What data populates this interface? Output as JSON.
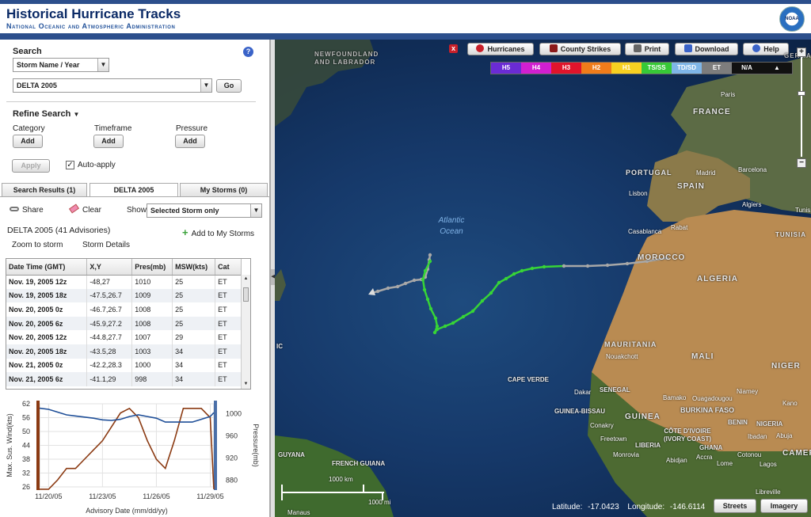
{
  "header": {
    "title": "Historical Hurricane Tracks",
    "subtitle": "National Oceanic and Atmospheric Administration",
    "logo_text": "NOAA"
  },
  "search": {
    "heading": "Search",
    "help": "?",
    "mode_select": "Storm Name / Year",
    "storm_value": "DELTA 2005",
    "go_label": "Go"
  },
  "refine": {
    "heading": "Refine Search",
    "category_label": "Category",
    "timeframe_label": "Timeframe",
    "pressure_label": "Pressure",
    "add_label": "Add",
    "apply_label": "Apply",
    "autoapply_label": "Auto-apply"
  },
  "tabs": [
    {
      "label": "Search Results (1)"
    },
    {
      "label": "DELTA 2005"
    },
    {
      "label": "My Storms (0)"
    }
  ],
  "toolbar": {
    "share_label": "Share",
    "clear_label": "Clear",
    "show_label": "Show",
    "show_value": "Selected Storm only"
  },
  "storm": {
    "title": "DELTA 2005 (41 Advisories)",
    "add_to_my_storms": "Add to My Storms",
    "zoom_label": "Zoom to storm",
    "details_label": "Storm Details"
  },
  "table": {
    "headers": [
      "Date Time (GMT)",
      "X,Y",
      "Pres(mb)",
      "MSW(kts)",
      "Cat"
    ],
    "rows": [
      [
        "Nov. 19, 2005 12z",
        "-48,27",
        "1010",
        "25",
        "ET"
      ],
      [
        "Nov. 19, 2005 18z",
        "-47.5,26.7",
        "1009",
        "25",
        "ET"
      ],
      [
        "Nov. 20, 2005 0z",
        "-46.7,26.7",
        "1008",
        "25",
        "ET"
      ],
      [
        "Nov. 20, 2005 6z",
        "-45.9,27.2",
        "1008",
        "25",
        "ET"
      ],
      [
        "Nov. 20, 2005 12z",
        "-44.8,27.7",
        "1007",
        "29",
        "ET"
      ],
      [
        "Nov. 20, 2005 18z",
        "-43.5,28",
        "1003",
        "34",
        "ET"
      ],
      [
        "Nov. 21, 2005 0z",
        "-42.2,28.3",
        "1000",
        "34",
        "ET"
      ],
      [
        "Nov. 21, 2005 6z",
        "-41.1,29",
        "998",
        "34",
        "ET"
      ]
    ]
  },
  "chart_data": {
    "type": "line",
    "xlabel": "Advisory Date (mm/dd/yy)",
    "ylabel": "Max. Sus. Wind(kts)",
    "y2label": "Pressure(mb)",
    "x_ticks": [
      "11/20/05",
      "11/23/05",
      "11/26/05",
      "11/29/05"
    ],
    "y_ticks": [
      26,
      32,
      38,
      44,
      50,
      56,
      62
    ],
    "y2_ticks": [
      880,
      920,
      960,
      1000
    ],
    "ylim": [
      26,
      62
    ],
    "y2lim": [
      868,
      1018
    ],
    "x": [
      19.5,
      20.0,
      20.5,
      21.0,
      21.5,
      22.0,
      22.5,
      23.0,
      23.5,
      24.0,
      24.5,
      25.0,
      25.5,
      26.0,
      26.5,
      27.0,
      27.5,
      28.0,
      28.5,
      29.0,
      29.2
    ],
    "series": [
      {
        "values": [
          25,
          25,
          29,
          34,
          34,
          38,
          42,
          46,
          52,
          58,
          60,
          56,
          46,
          38,
          34,
          46,
          60,
          60,
          60,
          56,
          25
        ],
        "color": "#8b3a12"
      },
      {
        "values": [
          1010,
          1008,
          1003,
          998,
          996,
          994,
          992,
          989,
          988,
          990,
          995,
          998,
          995,
          992,
          985,
          985,
          985,
          985,
          990,
          995,
          1002
        ],
        "color": "#1f4f98"
      }
    ]
  },
  "map": {
    "buttons": {
      "hurricanes": "Hurricanes",
      "county_strikes": "County Strikes",
      "print": "Print",
      "download": "Download",
      "help": "Help"
    },
    "close": "x",
    "legend": [
      {
        "label": "H5",
        "bg": "#6a2bd4",
        "fg": "#ffffff"
      },
      {
        "label": "H4",
        "bg": "#d11fd1",
        "fg": "#ffffff"
      },
      {
        "label": "H3",
        "bg": "#e0142b",
        "fg": "#ffffff"
      },
      {
        "label": "H2",
        "bg": "#f07c1a",
        "fg": "#ffffff"
      },
      {
        "label": "H1",
        "bg": "#f7d021",
        "fg": "#ffffff"
      },
      {
        "label": "TS/SS",
        "bg": "#37c937",
        "fg": "#ffffff"
      },
      {
        "label": "TD/SD",
        "bg": "#7fb6e8",
        "fg": "#ffffff"
      },
      {
        "label": "ET",
        "bg": "#7d7d7d",
        "fg": "#ffffff"
      },
      {
        "label": "N/A",
        "bg": "#111111",
        "fg": "#ffffff"
      },
      {
        "label": "▲",
        "bg": "#111111",
        "fg": "#ffffff"
      }
    ],
    "places": {
      "newfoundland": "NEWFOUNDLAND AND LABRADOR",
      "france": "FRANCE",
      "paris": "Paris",
      "portugal": "PORTUGAL",
      "spain": "SPAIN",
      "madrid": "Madrid",
      "barcelona": "Barcelona",
      "lisbon": "Lisbon",
      "algiers": "Algiers",
      "tunis": "Tunis",
      "tunisia": "TUNISIA",
      "rabat": "Rabat",
      "casablanca": "Casablanca",
      "morocco": "MOROCCO",
      "algeria": "ALGERIA",
      "germany": "GERMA",
      "ocean": "Atlantic Ocean",
      "mauritania": "MAURITANIA",
      "nouakchott": "Nouakchott",
      "mali": "MALI",
      "niger": "NIGER",
      "cape_verde": "CAPE VERDE",
      "dakar": "Dakar",
      "senegal": "SENEGAL",
      "bamako": "Bamako",
      "ouagadougou": "Ouagadougou",
      "niamey": "Niamey",
      "burkina_faso": "BURKINA FASO",
      "kano": "Kano",
      "guinea_bissau": "GUINEA-BISSAU",
      "guinea": "GUINEA",
      "conakry": "Conakry",
      "freetown": "Freetown",
      "cote_divoire": "CÔTE D'IVOIRE (IVORY COAST)",
      "benin": "BENIN",
      "nigeria": "NIGERIA",
      "ibadan": "Ibadan",
      "abuja": "Abuja",
      "liberia": "LIBERIA",
      "monrovia": "Monrovia",
      "abidjan": "Abidjan",
      "ghana": "GHANA",
      "accra": "Accra",
      "lome": "Lome",
      "cotonou": "Cotonou",
      "lagos": "Lagos",
      "camer": "CAMER",
      "libreville": "Libreville",
      "guyana": "GUYANA",
      "french_guiana": "FRENCH GUIANA",
      "manaus": "Manaus",
      "ic": "IC"
    },
    "scale_km": "1000 km",
    "scale_mi": "1000 mi",
    "latitude_label": "Latitude:",
    "latitude_value": "-17.0423",
    "longitude_label": "Longitude:",
    "longitude_value": "-146.6114",
    "streets_label": "Streets",
    "imagery_label": "Imagery",
    "track_colors": {
      "et": "#a8a8a8",
      "ts": "#37d437"
    }
  }
}
